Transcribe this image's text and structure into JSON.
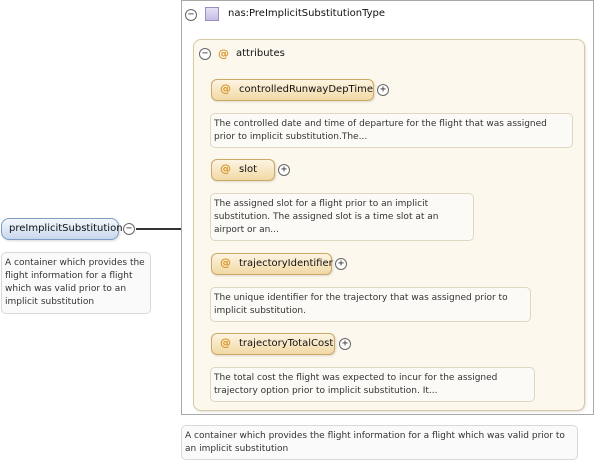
{
  "element": {
    "name": "preImplicitSubstitution",
    "description": "A container which provides the flight information for a flight which was valid prior to an implicit substitution",
    "collapse_toggle": "−"
  },
  "type": {
    "name": "nas:PreImplicitSubstitutionType",
    "collapse_toggle": "−",
    "description": "A container which provides the flight information for a flight which was valid prior to an implicit substitution"
  },
  "attributes": {
    "label": "attributes",
    "collapse_toggle": "−",
    "icon": "@",
    "items": [
      {
        "name": "controlledRunwayDepTime",
        "expand_toggle": "+",
        "description": "The controlled date and time of departure for the flight that was assigned prior to implicit substitution.The..."
      },
      {
        "name": "slot",
        "expand_toggle": "+",
        "description": "The assigned slot for a flight prior to an implicit substitution. The assigned slot is a time slot at an airport or an..."
      },
      {
        "name": "trajectoryIdentifier",
        "expand_toggle": "+",
        "description": "The unique identifier for the trajectory that was assigned prior to implicit substitution."
      },
      {
        "name": "trajectoryTotalCost",
        "expand_toggle": "+",
        "description": "The total cost the flight was expected to incur for the assigned trajectory option prior to implicit substitution. It..."
      }
    ]
  },
  "colors": {
    "element_fill": "#c9d8ee",
    "attribute_fill": "#f1d9a6",
    "attribute_icon": "#d7952a",
    "type_icon": "#c7bce6"
  }
}
